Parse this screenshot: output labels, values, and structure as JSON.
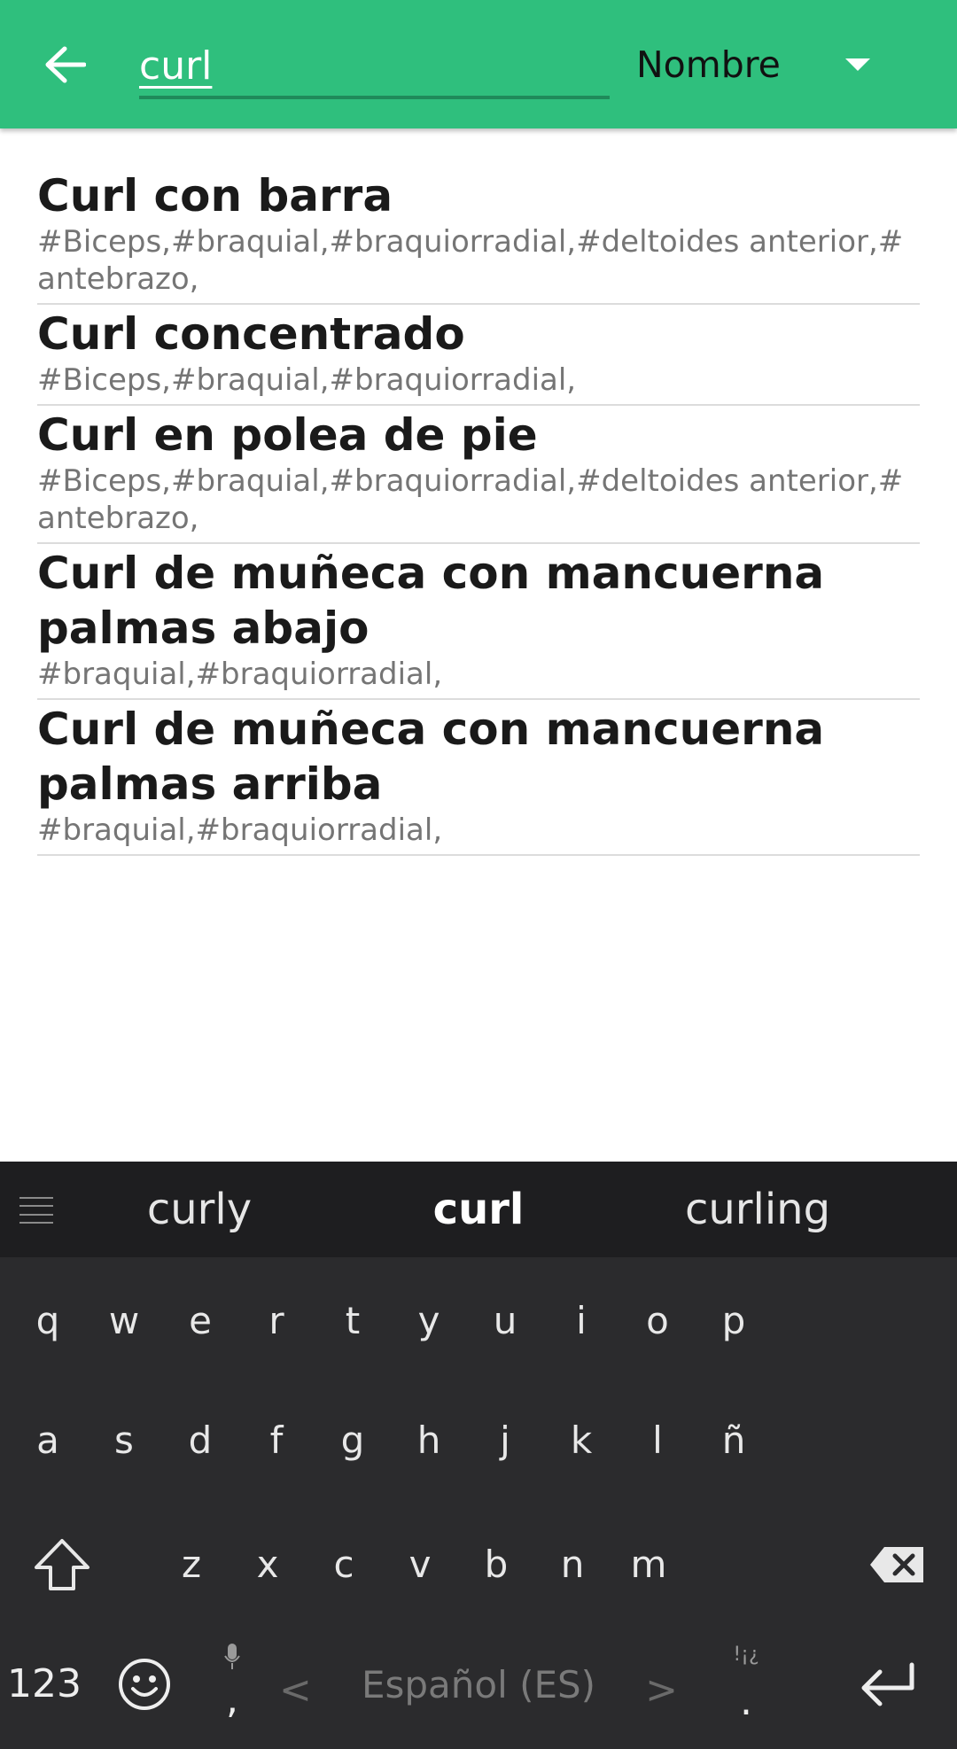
{
  "header": {
    "search_value": "curl",
    "sort_value": "Nombre"
  },
  "results": [
    {
      "title": "Curl con barra",
      "tags": "#Biceps,#braquial,#braquiorradial,#deltoides anterior,#antebrazo,"
    },
    {
      "title": "Curl concentrado",
      "tags": "#Biceps,#braquial,#braquiorradial,"
    },
    {
      "title": "Curl en polea de pie",
      "tags": "#Biceps,#braquial,#braquiorradial,#deltoides anterior,#antebrazo,"
    },
    {
      "title": "Curl de muñeca con mancuerna palmas abajo",
      "tags": "#braquial,#braquiorradial,"
    },
    {
      "title": "Curl de muñeca con mancuerna palmas arriba",
      "tags": "#braquial,#braquiorradial,"
    }
  ],
  "keyboard": {
    "suggestions": [
      "curly",
      "curl",
      "curling"
    ],
    "row1": [
      "q",
      "w",
      "e",
      "r",
      "t",
      "y",
      "u",
      "i",
      "o",
      "p"
    ],
    "row2": [
      "a",
      "s",
      "d",
      "f",
      "g",
      "h",
      "j",
      "k",
      "l",
      "ñ"
    ],
    "row3": [
      "z",
      "x",
      "c",
      "v",
      "b",
      "n",
      "m"
    ],
    "numbers_label": "123",
    "comma": ",",
    "space_label": "Español (ES)",
    "chevron_left": "<",
    "chevron_right": ">",
    "period_sub": "!¡¿",
    "period": ".",
    "icons": [
      "back-arrow-icon",
      "dropdown-arrow-icon",
      "menu-icon",
      "shift-icon",
      "backspace-icon",
      "emoji-icon",
      "mic-icon",
      "enter-icon"
    ]
  },
  "colors": {
    "appbar": "#2fbf7d",
    "keyboard_bg": "#2b2b2d",
    "suggestion_bar": "#1e1e20"
  }
}
